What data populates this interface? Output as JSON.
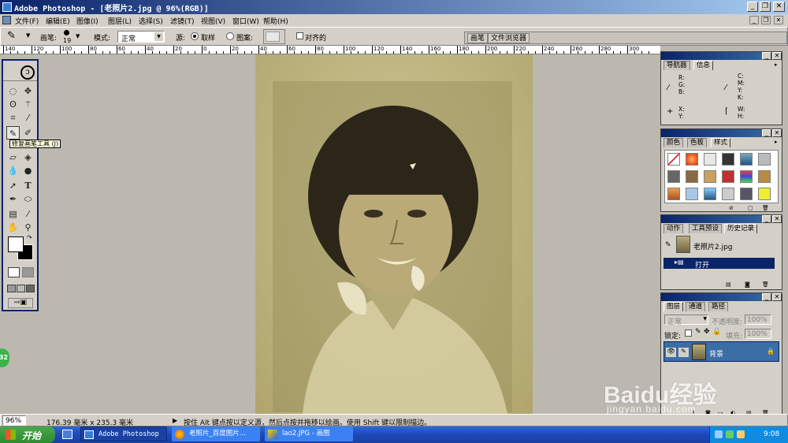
{
  "app": {
    "title": "Adobe Photoshop - [老照片2.jpg @ 96%(RGB)]",
    "brand_color": "#0a246a"
  },
  "menu": [
    "文件(F)",
    "编辑(E)",
    "图像(I)",
    "图层(L)",
    "选择(S)",
    "滤镜(T)",
    "视图(V)",
    "窗口(W)",
    "帮助(H)"
  ],
  "options": {
    "brush_label": "画笔:",
    "brush_size": "19",
    "mode_label": "模式:",
    "mode_value": "正常",
    "source_label": "源:",
    "sample_label": "取样",
    "pattern_label": "图案:",
    "aligned_label": "对齐的",
    "tabs": [
      "画笔",
      "文件浏览器"
    ]
  },
  "ruler": {
    "h_ticks": [
      "140",
      "120",
      "100",
      "80",
      "60",
      "40",
      "20",
      "0",
      "20",
      "40",
      "60",
      "80",
      "100",
      "120",
      "140",
      "160",
      "180",
      "200",
      "220",
      "240",
      "260",
      "280",
      "300"
    ]
  },
  "tooltip": "修复画笔工具 (J)",
  "navigator": {
    "tabs": [
      "导航器",
      "信息"
    ],
    "rgb": "R:\nG:\nB:",
    "cmyk": "C:\nM:\nY:\nK:",
    "xy": "X:\nY:",
    "wh": "W:\nH:"
  },
  "color_palette": {
    "tabs": [
      "颜色",
      "色板",
      "样式"
    ]
  },
  "history": {
    "tabs": [
      "动作",
      "工具预设",
      "历史记录"
    ],
    "snapshot": "老照片2.jpg",
    "states": [
      "打开"
    ]
  },
  "layers": {
    "tabs": [
      "图层",
      "通道",
      "路径"
    ],
    "blend": "正常",
    "opacity_label": "不透明度:",
    "opacity": "100%",
    "lock_label": "锁定:",
    "fill_label": "填充:",
    "fill": "100%",
    "layer_name": "背景"
  },
  "status": {
    "zoom": "96%",
    "doc_size": "176.39 毫米 x 235.3 毫米",
    "hint": "按住 Alt 键点按以定义源，然后点按并拖移以绘画。使用 Shift 键以限制描边。"
  },
  "taskbar": {
    "start": "开始",
    "items": [
      "Adobe Photoshop ...",
      "老照片_百度图片...",
      "lao2.JPG - 画图"
    ],
    "clock": "9:08"
  },
  "watermark": {
    "brand": "Baidu经验",
    "url": "jingyan.baidu.com"
  },
  "side_badge": "32"
}
